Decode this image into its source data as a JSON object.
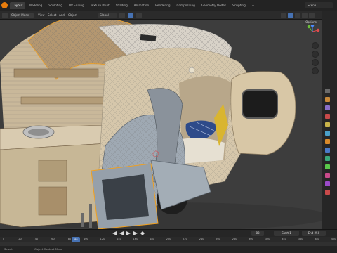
{
  "app": {
    "workspace_tabs": [
      "Layout",
      "Modeling",
      "Sculpting",
      "UV Editing",
      "Texture Paint",
      "Shading",
      "Animation",
      "Rendering",
      "Compositing",
      "Geometry Nodes",
      "Scripting",
      "+"
    ],
    "active_tab": "Layout",
    "scene_name": "Scene"
  },
  "header": {
    "mode": "Object Mode",
    "menus": [
      "View",
      "Select",
      "Add",
      "Object"
    ],
    "transform_orientation": "Global",
    "options_label": "Options"
  },
  "timeline": {
    "start_label": "Start",
    "start": 1,
    "end_label": "End",
    "end": 250,
    "current_frame": 88,
    "ruler_ticks": [
      0,
      20,
      40,
      60,
      80,
      100,
      120,
      140,
      160,
      180,
      200,
      220,
      240,
      260,
      280,
      300,
      320,
      340,
      360,
      380,
      400
    ],
    "current_display": "88"
  },
  "status": {
    "left": "Select",
    "middle": "Object Context Menu"
  },
  "colors": {
    "accent": "#4772b3",
    "brand": "#e87d0d",
    "viewport_bg": "#3d3d3d",
    "selection_outline": "#f0a020"
  },
  "icons": [
    "blender-logo-icon",
    "navigation-gizmo-icon",
    "zoom-icon",
    "pan-icon",
    "camera-view-icon",
    "perspective-toggle-icon",
    "play-icon",
    "jump-start-icon",
    "jump-end-icon",
    "keyframe-icon"
  ]
}
